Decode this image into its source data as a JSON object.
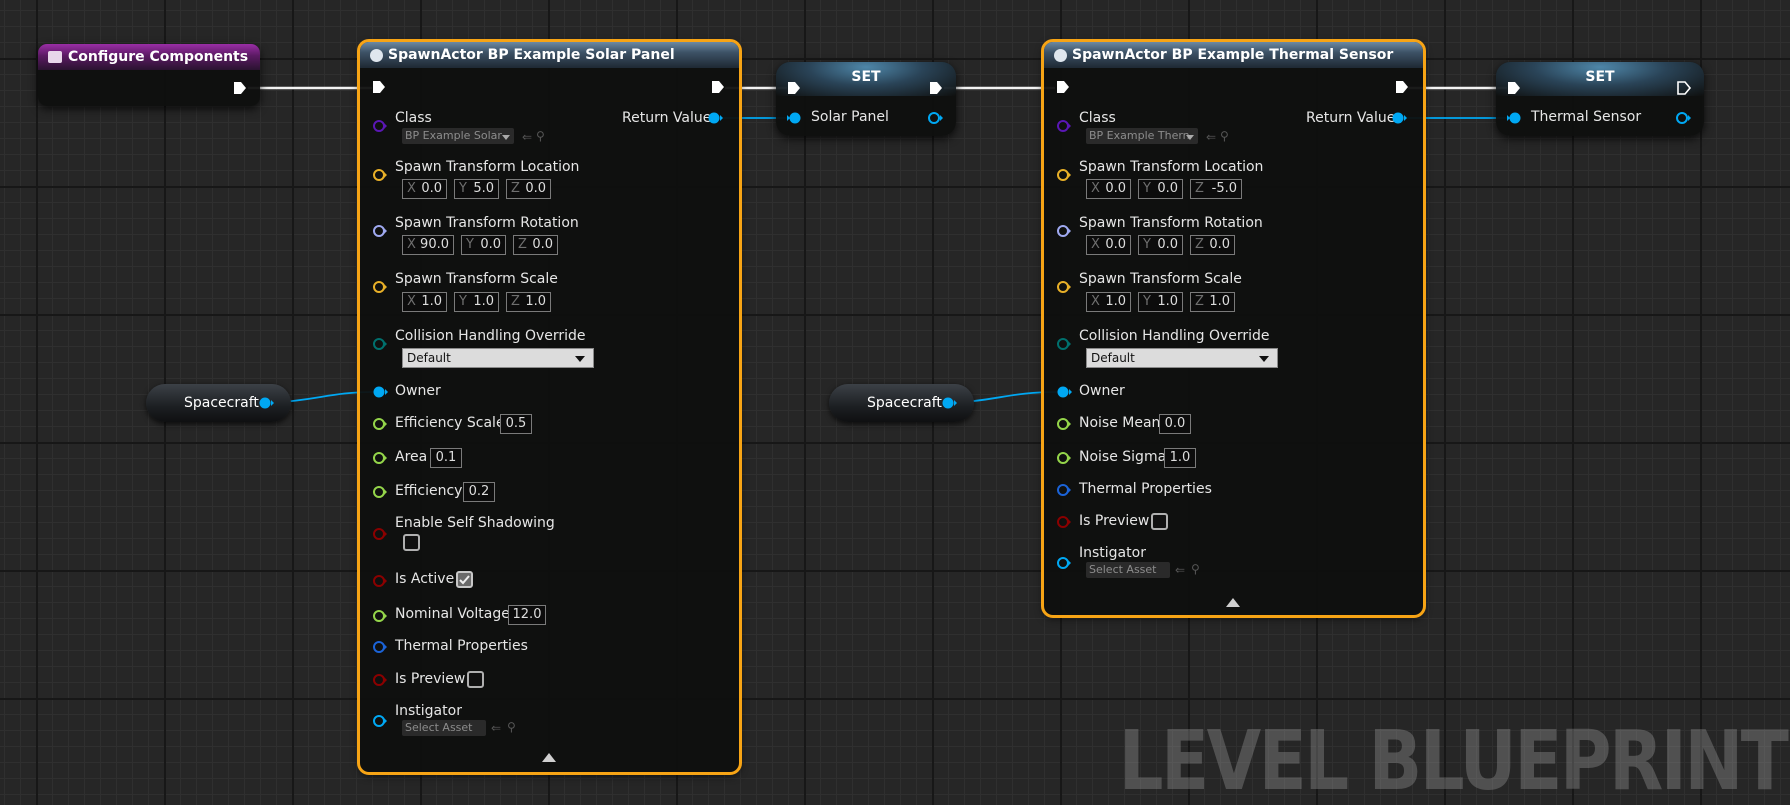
{
  "watermark": "LEVEL BLUEPRINT",
  "colors": {
    "exec": "#ffffff",
    "object_pin": "#00a8f3",
    "float_pin": "#94d54a",
    "vector_pin": "#e8b028",
    "rotator_pin": "#9fa9f0",
    "enum_pin": "#00706d",
    "class_pin": "#5a17b4",
    "bool_pin": "#8b0000",
    "struct_pin": "#1b63d7",
    "selection_outline": "#f7a415",
    "event_header": "#9a2ea6",
    "function_header": "#3d5266",
    "set_header": "#2a4458"
  },
  "event_node": {
    "title": "Configure Components",
    "icon": "event-icon"
  },
  "spawn_solar": {
    "title": "SpawnActor BP Example Solar Panel",
    "icon": "function-icon",
    "class_label": "Class",
    "class_value": "BP Example Solar",
    "return_label": "Return Value",
    "loc_label": "Spawn Transform Location",
    "loc": {
      "x": "0.0",
      "y": "5.0",
      "z": "0.0"
    },
    "rot_label": "Spawn Transform Rotation",
    "rot": {
      "x": "90.0",
      "y": "0.0",
      "z": "0.0"
    },
    "scale_label": "Spawn Transform Scale",
    "scale": {
      "x": "1.0",
      "y": "1.0",
      "z": "1.0"
    },
    "collision_label": "Collision Handling Override",
    "collision_value": "Default",
    "owner_label": "Owner",
    "efficiency_scale_label": "Efficiency Scale",
    "efficiency_scale": "0.5",
    "area_label": "Area",
    "area": "0.1",
    "efficiency_label": "Efficiency",
    "efficiency": "0.2",
    "self_shadow_label": "Enable Self Shadowing",
    "self_shadow_checked": false,
    "is_active_label": "Is Active",
    "is_active_checked": true,
    "voltage_label": "Nominal Voltage",
    "voltage": "12.0",
    "thermal_label": "Thermal Properties",
    "preview_label": "Is Preview",
    "preview_checked": false,
    "instigator_label": "Instigator",
    "instigator_value": "Select Asset"
  },
  "spawn_thermal": {
    "title": "SpawnActor BP Example Thermal Sensor",
    "icon": "function-icon",
    "class_label": "Class",
    "class_value": "BP Example Thern",
    "return_label": "Return Value",
    "loc_label": "Spawn Transform Location",
    "loc": {
      "x": "0.0",
      "y": "0.0",
      "z": "-5.0"
    },
    "rot_label": "Spawn Transform Rotation",
    "rot": {
      "x": "0.0",
      "y": "0.0",
      "z": "0.0"
    },
    "scale_label": "Spawn Transform Scale",
    "scale": {
      "x": "1.0",
      "y": "1.0",
      "z": "1.0"
    },
    "collision_label": "Collision Handling Override",
    "collision_value": "Default",
    "owner_label": "Owner",
    "noise_mean_label": "Noise Mean",
    "noise_mean": "0.0",
    "noise_sigma_label": "Noise Sigma",
    "noise_sigma": "1.0",
    "thermal_label": "Thermal Properties",
    "preview_label": "Is Preview",
    "preview_checked": false,
    "instigator_label": "Instigator",
    "instigator_value": "Select Asset"
  },
  "set_solar": {
    "title": "SET",
    "var_label": "Solar Panel"
  },
  "set_thermal": {
    "title": "SET",
    "var_label": "Thermal Sensor"
  },
  "var_spacecraft_1": {
    "label": "Spacecraft"
  },
  "var_spacecraft_2": {
    "label": "Spacecraft"
  },
  "axis_labels": {
    "x": "X",
    "y": "Y",
    "z": "Z"
  }
}
